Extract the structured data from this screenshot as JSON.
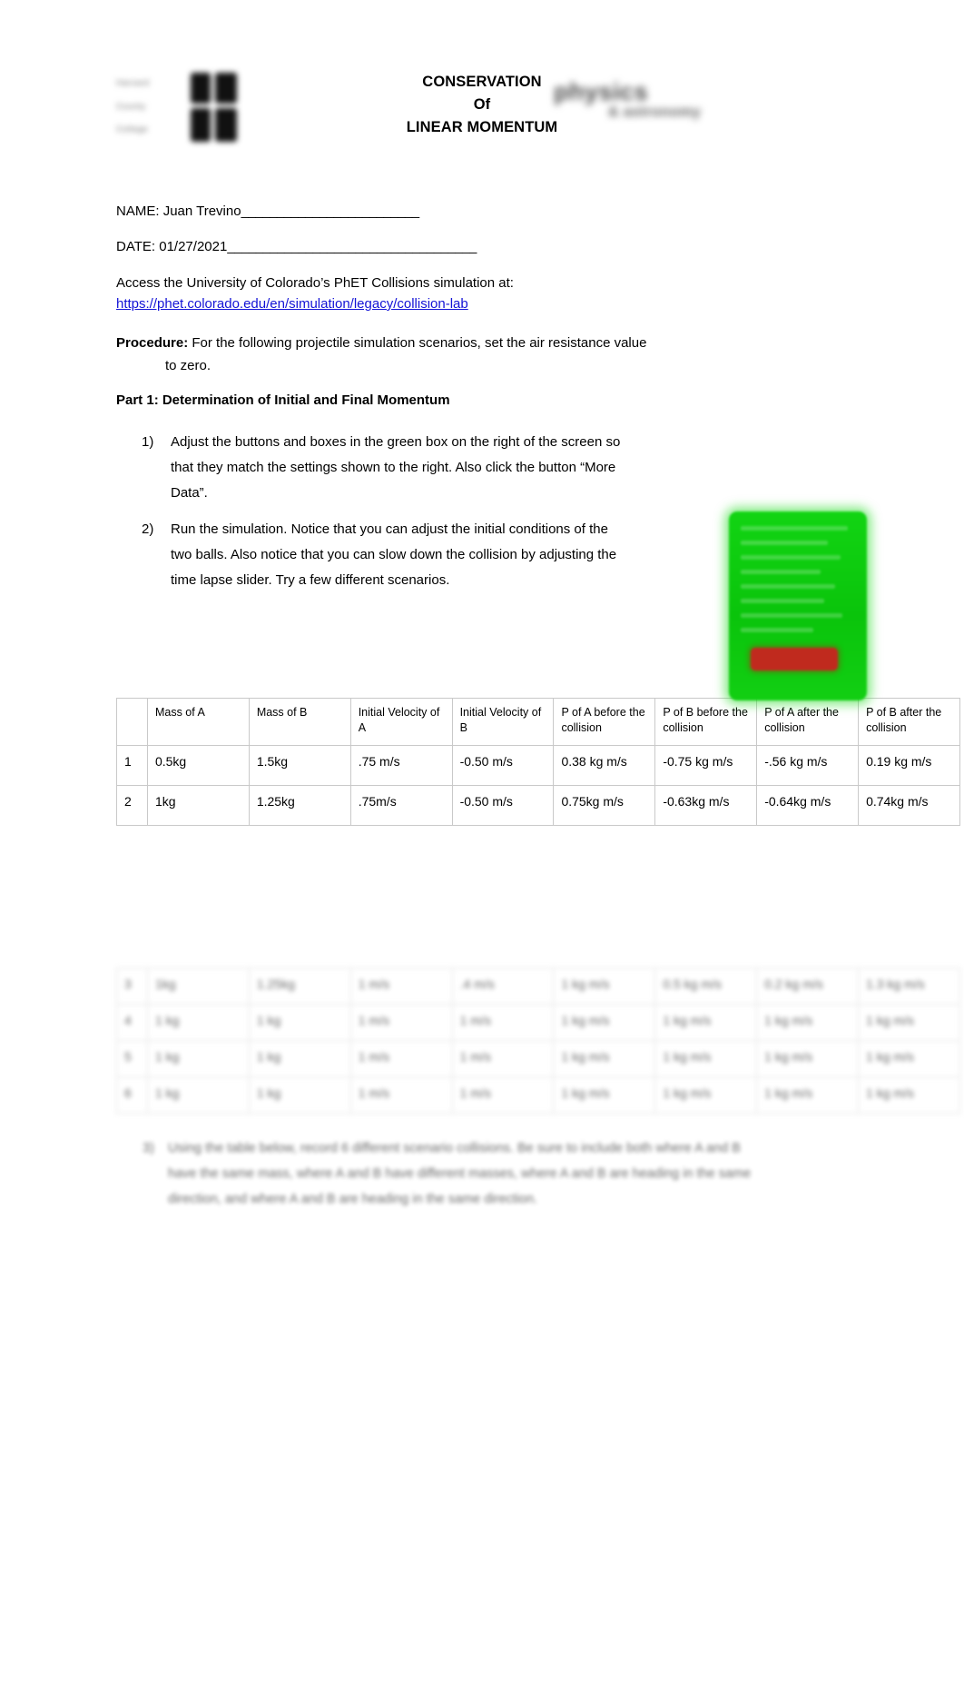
{
  "header": {
    "title_lines": [
      "CONSERVATION",
      "Of",
      "LINEAR MOMENTUM"
    ],
    "logo_left": {
      "name": "college-logo",
      "text_lines": [
        "Harvard",
        "County",
        "College"
      ],
      "alt": "blurred college logo"
    },
    "logo_right": {
      "name": "physics-astronomy-logo",
      "main": "physics",
      "sub": "& astronomy"
    }
  },
  "fields": {
    "name_label": "NAME:",
    "name_value": "Juan Trevino",
    "name_rule": "_________________________",
    "date_label": "DATE:",
    "date_value": "01/27/2021",
    "date_rule": "___________________________________"
  },
  "intro": {
    "access_text": "Access the University of Colorado’s PhET Collisions simulation at:",
    "url": "https://phet.colorado.edu/en/simulation/legacy/collision-lab"
  },
  "procedure": {
    "label": "Procedure:",
    "text": "For the following projectile simulation scenarios, set the air resistance value",
    "continuation": "to zero."
  },
  "part1": {
    "heading": "Part 1: Determination of Initial and Final Momentum",
    "steps": [
      {
        "num": "1)",
        "text": "Adjust the buttons and boxes in the green box on the right of the screen so that they match the settings shown to the right.  Also click the button “More Data”."
      },
      {
        "num": "2)",
        "text": "Run the simulation.  Notice that you can adjust the initial conditions of the two balls.  Also notice that you can slow down the collision by adjusting the time lapse slider.  Try a few different scenarios."
      }
    ]
  },
  "table": {
    "headers": [
      "",
      "Mass of A",
      "Mass of B",
      "Initial Velocity of A",
      "Initial Velocity of B",
      "P of A before the collision",
      "P of B before the collision",
      "P of A after the collision",
      "P of B after the collision"
    ],
    "rows": [
      [
        "1",
        "0.5kg",
        "1.5kg",
        ".75 m/s",
        "-0.50 m/s",
        "0.38 kg m/s",
        "-0.75 kg m/s",
        "-.56 kg m/s",
        "0.19 kg m/s"
      ],
      [
        "2",
        "1kg",
        "1.25kg",
        ".75m/s",
        "-0.50 m/s",
        "0.75kg m/s",
        "-0.63kg m/s",
        "-0.64kg m/s",
        "0.74kg m/s"
      ]
    ]
  },
  "table_continued": {
    "rows": [
      [
        "3",
        "1kg",
        "1.25kg",
        "1 m/s",
        ".4 m/s",
        "1 kg m/s",
        "0.5 kg m/s",
        "0.2 kg m/s",
        "1.3 kg m/s"
      ],
      [
        "4",
        "1 kg",
        "1 kg",
        "1 m/s",
        "1 m/s",
        "1 kg m/s",
        "1 kg m/s",
        "1 kg m/s",
        "1 kg m/s"
      ],
      [
        "5",
        "1 kg",
        "1 kg",
        "1 m/s",
        "1 m/s",
        "1 kg m/s",
        "1 kg m/s",
        "1 kg m/s",
        "1 kg m/s"
      ],
      [
        "6",
        "1 kg",
        "1 kg",
        "1 m/s",
        "1 m/s",
        "1 kg m/s",
        "1 kg m/s",
        "1 kg m/s",
        "1 kg m/s"
      ]
    ]
  },
  "closing": {
    "num": "3)",
    "text": "Using the table below, record 6 different scenario collisions.  Be sure to include both where A and B have the same mass, where A and B have different masses, where A and B are heading in the same direction, and where A and B are heading in the same direction."
  },
  "sim_overlay": {
    "name": "phet-settings-panel",
    "button_label": "More Data",
    "panel_color": "#0ec40f",
    "button_color": "#c02a1e"
  }
}
